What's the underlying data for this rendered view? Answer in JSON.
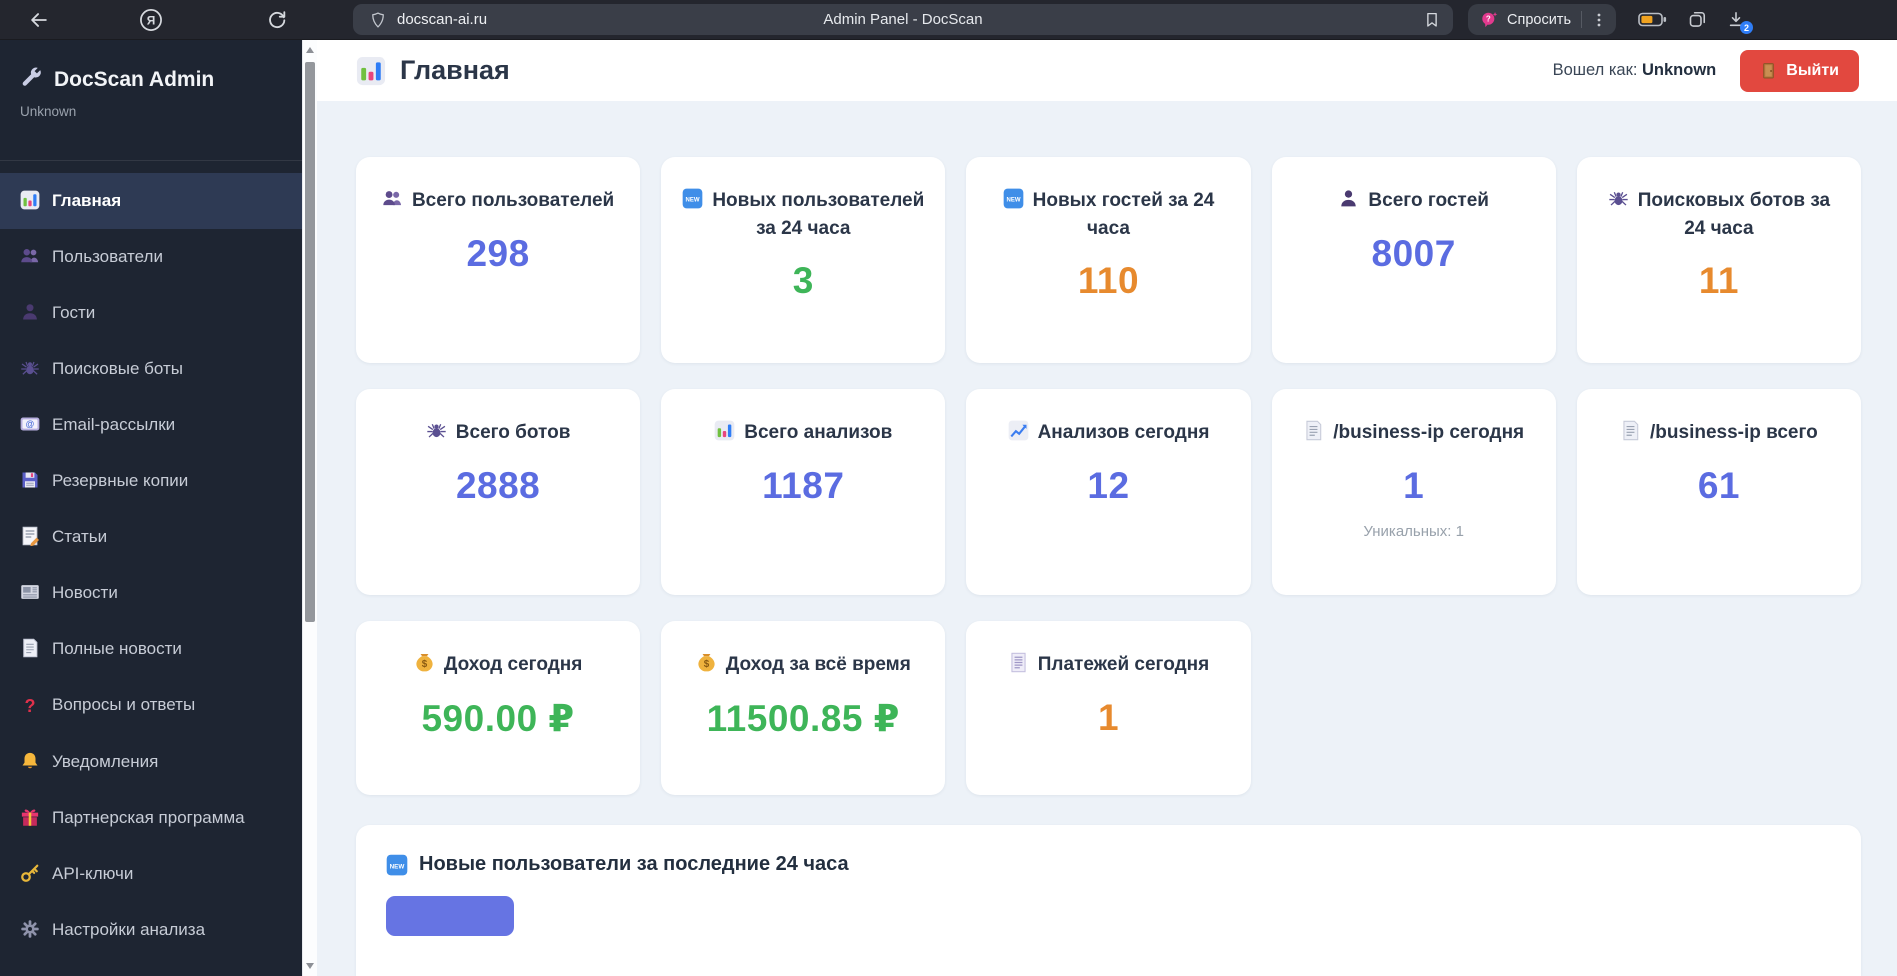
{
  "browser_bar": {
    "url": "docscan-ai.ru",
    "page_title": "Admin Panel - DocScan",
    "ask_label": "Спросить",
    "download_count": "2"
  },
  "sidebar": {
    "brand": "DocScan Admin",
    "subtitle": "Unknown",
    "items": [
      {
        "label": "Главная",
        "icon": "bar-chart",
        "active": true
      },
      {
        "label": "Пользователи",
        "icon": "users"
      },
      {
        "label": "Гости",
        "icon": "person"
      },
      {
        "label": "Поисковые боты",
        "icon": "spider"
      },
      {
        "label": "Email-рассылки",
        "icon": "email"
      },
      {
        "label": "Резервные копии",
        "icon": "floppy-disk"
      },
      {
        "label": "Статьи",
        "icon": "memo"
      },
      {
        "label": "Новости",
        "icon": "newspaper"
      },
      {
        "label": "Полные новости",
        "icon": "document"
      },
      {
        "label": "Вопросы и ответы",
        "icon": "question"
      },
      {
        "label": "Уведомления",
        "icon": "bell"
      },
      {
        "label": "Партнерская программа",
        "icon": "gift"
      },
      {
        "label": "API-ключи",
        "icon": "key"
      },
      {
        "label": "Настройки анализа",
        "icon": "gear"
      }
    ]
  },
  "header": {
    "title": "Главная",
    "login_prefix": "Вошел как:",
    "login_user": "Unknown",
    "logout_label": "Выйти"
  },
  "cards": [
    {
      "label": "Всего пользователей",
      "value": "298",
      "color": "blue",
      "icon": "users"
    },
    {
      "label": "Новых пользователей за 24 часа",
      "value": "3",
      "color": "green",
      "icon": "new-badge"
    },
    {
      "label": "Новых гостей за 24 часа",
      "value": "110",
      "color": "orange",
      "icon": "new-badge"
    },
    {
      "label": "Всего гостей",
      "value": "8007",
      "color": "blue",
      "icon": "person"
    },
    {
      "label": "Поисковых ботов за 24 часа",
      "value": "11",
      "color": "orange",
      "icon": "spider"
    },
    {
      "label": "Всего ботов",
      "value": "2888",
      "color": "blue",
      "icon": "spider"
    },
    {
      "label": "Всего анализов",
      "value": "1187",
      "color": "blue",
      "icon": "bar-chart"
    },
    {
      "label": "Анализов сегодня",
      "value": "12",
      "color": "blue",
      "icon": "chart-up"
    },
    {
      "label": "/business-ip сегодня",
      "value": "1",
      "color": "blue",
      "icon": "document",
      "note": "Уникальных: 1"
    },
    {
      "label": "/business-ip всего",
      "value": "61",
      "color": "blue",
      "icon": "document"
    },
    {
      "label": "Доход сегодня",
      "value": "590.00 ₽",
      "color": "green",
      "icon": "money-bag"
    },
    {
      "label": "Доход за всё время",
      "value": "11500.85 ₽",
      "color": "green",
      "icon": "money-bag"
    },
    {
      "label": "Платежей сегодня",
      "value": "1",
      "color": "orange",
      "icon": "receipt"
    }
  ],
  "panel": {
    "title": "Новые пользователи за последние 24 часа"
  },
  "colors": {
    "value_blue": "#5b6ce1",
    "value_green": "#3eb558",
    "value_orange": "#e78a2e",
    "logout_red": "#e2483f",
    "panel_button_indigo": "#6674e3",
    "sidebar_bg": "#1e2532",
    "sidebar_active_bg": "#2e3a54",
    "content_bg": "#edf2f8",
    "chrome_bg": "#24262e",
    "download_badge_blue": "#2f7df6"
  }
}
